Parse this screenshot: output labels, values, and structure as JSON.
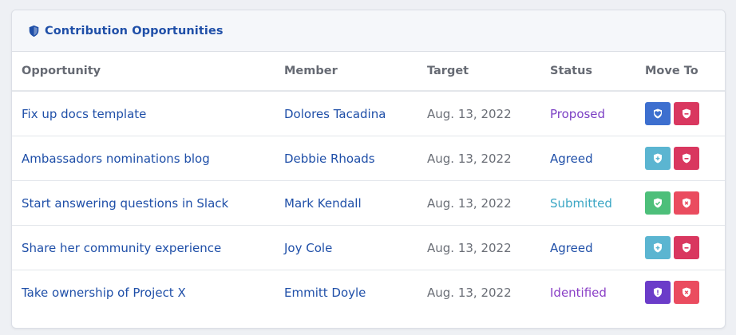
{
  "card": {
    "title": "Contribution Opportunities",
    "title_icon": "shield-icon"
  },
  "table": {
    "headers": {
      "opportunity": "Opportunity",
      "member": "Member",
      "target": "Target",
      "status": "Status",
      "move_to": "Move To"
    },
    "rows": [
      {
        "opportunity": "Fix up docs template",
        "member": "Dolores Tacadina",
        "target": "Aug. 13, 2022",
        "status": "Proposed",
        "status_color": "#7b3fc4",
        "buttons": [
          {
            "icon": "shield-heart-icon",
            "color": "#3d6fcf",
            "glyph": "heart"
          },
          {
            "icon": "shield-minus-icon",
            "color": "#d9375f",
            "glyph": "minus"
          }
        ]
      },
      {
        "opportunity": "Ambassadors nominations blog",
        "member": "Debbie Rhoads",
        "target": "Aug. 13, 2022",
        "status": "Agreed",
        "status_color": "#1f4fa8",
        "buttons": [
          {
            "icon": "shield-plus-icon",
            "color": "#5bb5d1",
            "glyph": "plus"
          },
          {
            "icon": "shield-minus-icon",
            "color": "#d9375f",
            "glyph": "minus"
          }
        ]
      },
      {
        "opportunity": "Start answering questions in Slack",
        "member": "Mark Kendall",
        "target": "Aug. 13, 2022",
        "status": "Submitted",
        "status_color": "#3aa6c4",
        "buttons": [
          {
            "icon": "shield-check-icon",
            "color": "#4dbf7a",
            "glyph": "check"
          },
          {
            "icon": "shield-x-icon",
            "color": "#ea4c5f",
            "glyph": "x"
          }
        ]
      },
      {
        "opportunity": "Share her community experience",
        "member": "Joy Cole",
        "target": "Aug. 13, 2022",
        "status": "Agreed",
        "status_color": "#1f4fa8",
        "buttons": [
          {
            "icon": "shield-plus-icon",
            "color": "#5bb5d1",
            "glyph": "plus"
          },
          {
            "icon": "shield-minus-icon",
            "color": "#d9375f",
            "glyph": "minus"
          }
        ]
      },
      {
        "opportunity": "Take ownership of Project X",
        "member": "Emmitt Doyle",
        "target": "Aug. 13, 2022",
        "status": "Identified",
        "status_color": "#8a3fc6",
        "buttons": [
          {
            "icon": "shield-exclamation-icon",
            "color": "#6b3cc9",
            "glyph": "exclaim"
          },
          {
            "icon": "shield-x-icon",
            "color": "#ea4c5f",
            "glyph": "x"
          }
        ]
      }
    ]
  }
}
